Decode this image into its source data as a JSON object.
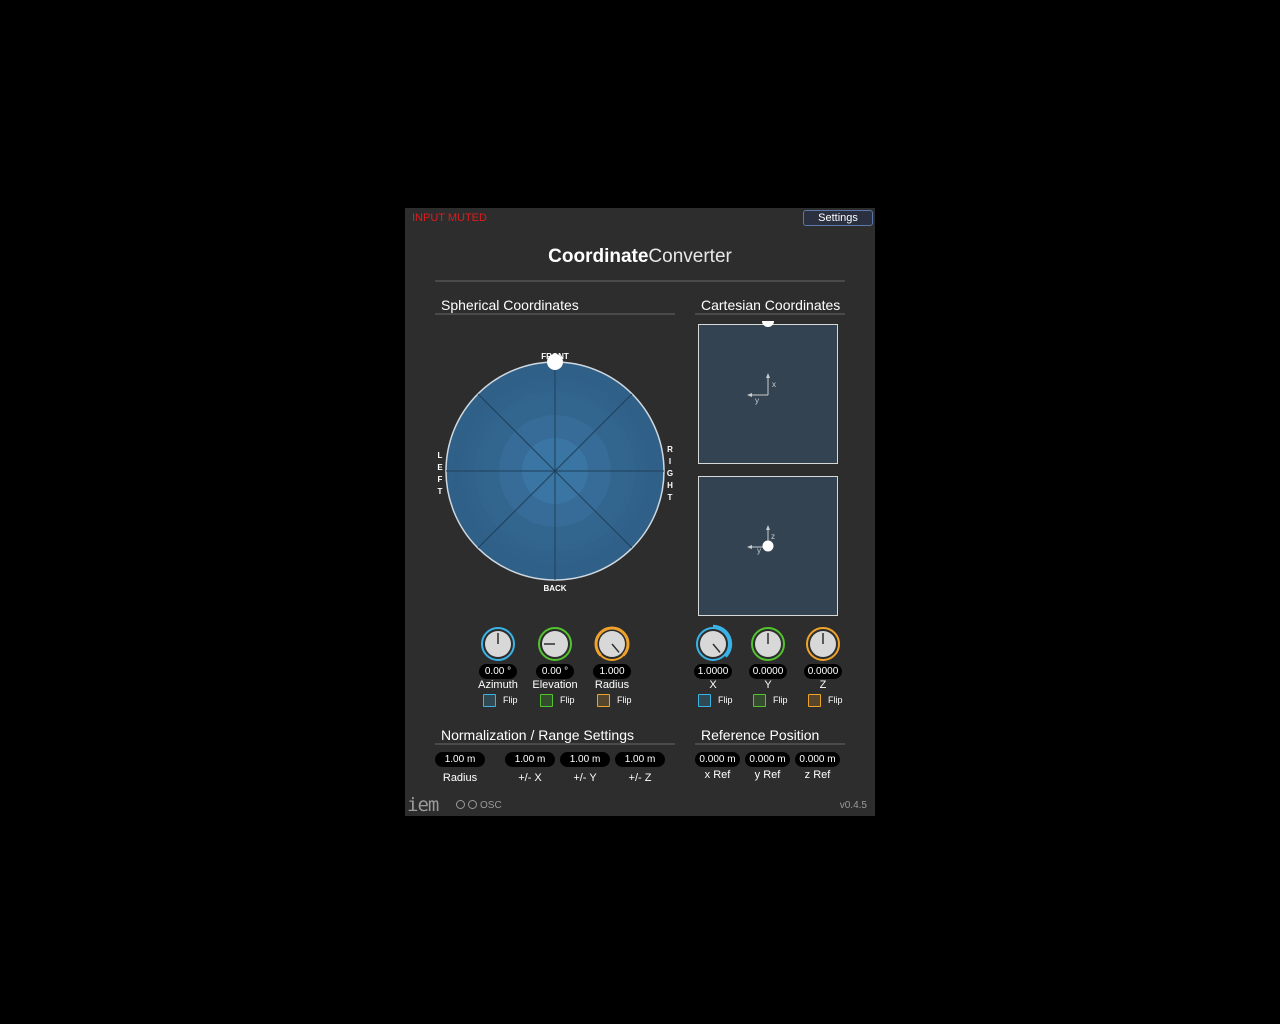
{
  "header": {
    "input_muted": "INPUT MUTED",
    "settings_label": "Settings",
    "title_bold": "Coordinate",
    "title_light": "Converter"
  },
  "spherical": {
    "title": "Spherical Coordinates",
    "labels": {
      "front": "FRONT",
      "back": "BACK",
      "left": "LEFT",
      "right": "RIGHT"
    },
    "knobs": [
      {
        "name": "Azimuth",
        "value": "0.00 °",
        "color": "#3ab3e6"
      },
      {
        "name": "Elevation",
        "value": "0.00 °",
        "color": "#52c42d"
      },
      {
        "name": "Radius",
        "value": "1.000",
        "color": "#f0a32a"
      }
    ],
    "flip_label": "Flip"
  },
  "cartesian": {
    "title": "Cartesian Coordinates",
    "top_axes": {
      "x": "x",
      "y": "y"
    },
    "bottom_axes": {
      "z": "z",
      "y": "y"
    },
    "knobs": [
      {
        "name": "X",
        "value": "1.0000",
        "color": "#3ab3e6"
      },
      {
        "name": "Y",
        "value": "0.0000",
        "color": "#52c42d"
      },
      {
        "name": "Z",
        "value": "0.0000",
        "color": "#f0a32a"
      }
    ],
    "flip_label": "Flip"
  },
  "normalization": {
    "title": "Normalization / Range Settings",
    "fields": [
      {
        "label": "Radius",
        "value": "1.00 m"
      },
      {
        "label": "+/- X",
        "value": "1.00 m"
      },
      {
        "label": "+/- Y",
        "value": "1.00 m"
      },
      {
        "label": "+/- Z",
        "value": "1.00 m"
      }
    ]
  },
  "reference": {
    "title": "Reference Position",
    "fields": [
      {
        "label": "x Ref",
        "value": "0.000 m"
      },
      {
        "label": "y Ref",
        "value": "0.000 m"
      },
      {
        "label": "z Ref",
        "value": "0.000 m"
      }
    ]
  },
  "footer": {
    "logo": "iem",
    "osc": "OSC",
    "version": "v0.4.5"
  }
}
